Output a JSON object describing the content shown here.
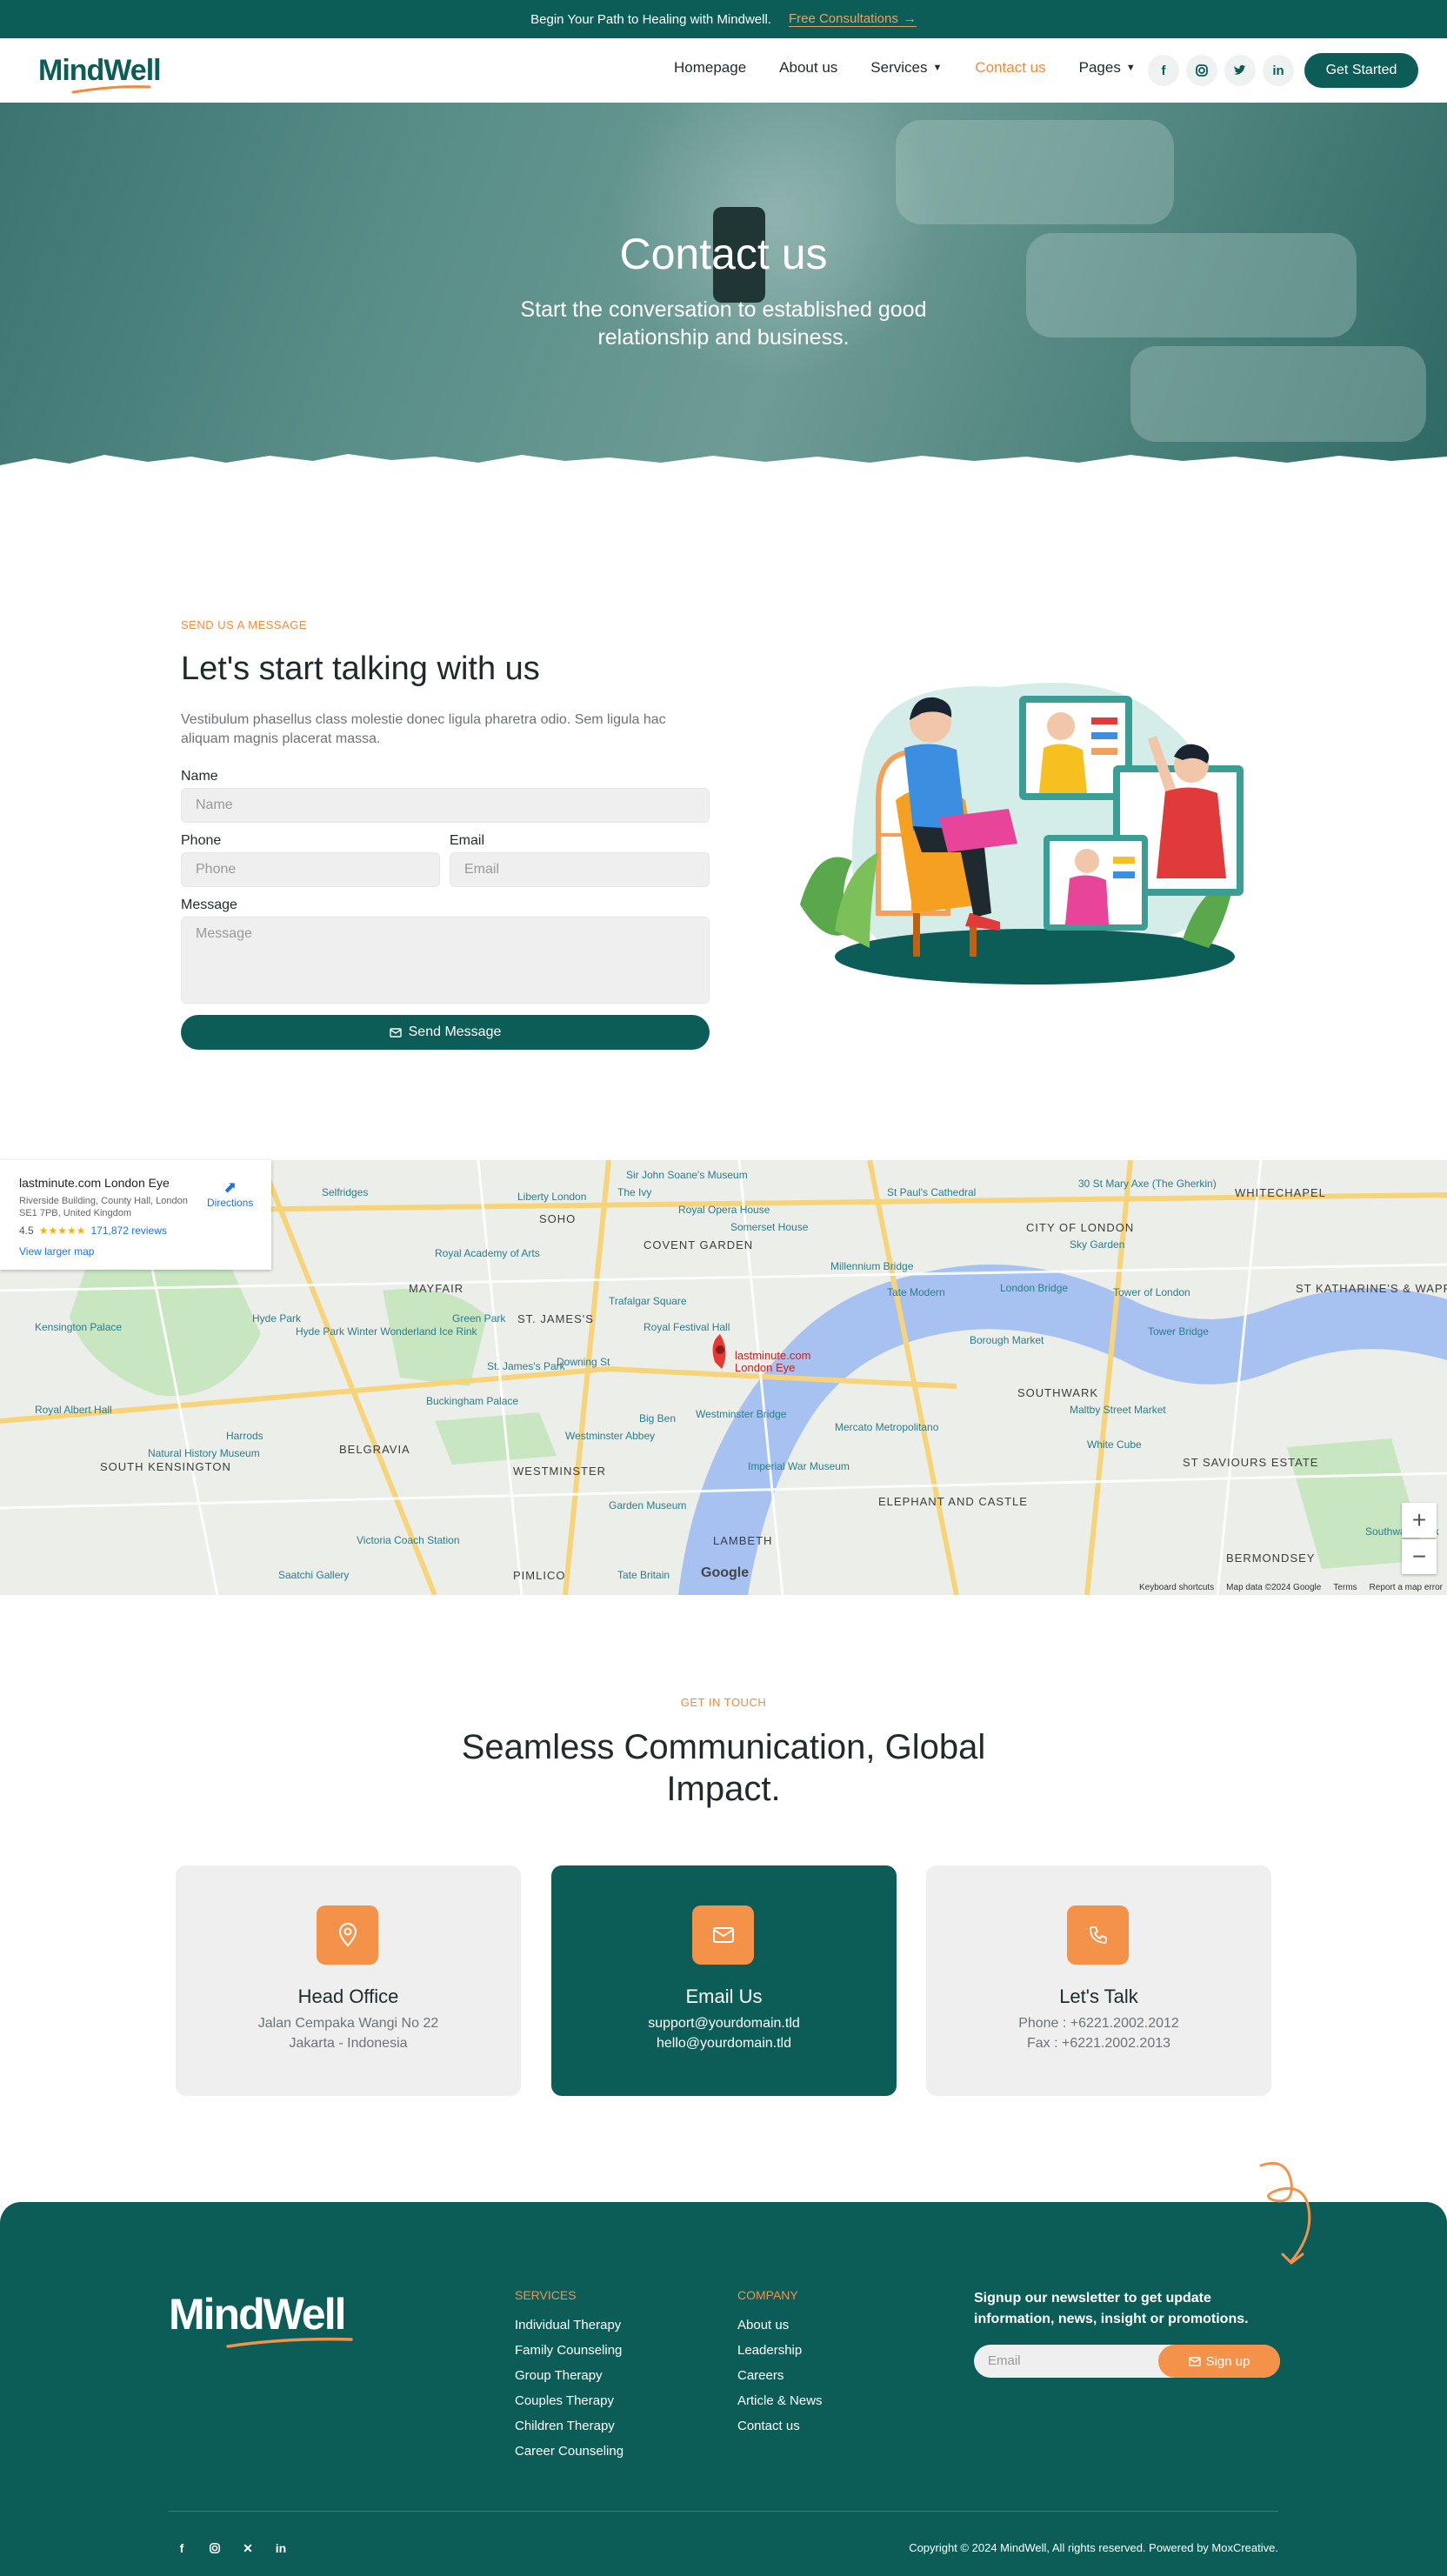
{
  "topbar": {
    "text": "Begin Your Path to Healing with Mindwell.",
    "link": "Free Consultations"
  },
  "nav": {
    "logo": "MindWell",
    "items": [
      {
        "label": "Homepage"
      },
      {
        "label": "About us"
      },
      {
        "label": "Services"
      },
      {
        "label": "Contact us"
      },
      {
        "label": "Pages"
      }
    ],
    "social_icons": [
      "facebook-icon",
      "instagram-icon",
      "twitter-icon",
      "linkedin-icon"
    ],
    "cta": "Get Started"
  },
  "hero": {
    "title": "Contact us",
    "subtitle": "Start the conversation to established good relationship and business."
  },
  "contact_form": {
    "eyebrow": "SEND US A MESSAGE",
    "title": "Let's start talking with us",
    "description": "Vestibulum phasellus class molestie donec ligula pharetra odio. Sem ligula hac aliquam magnis placerat massa.",
    "name_label": "Name",
    "name_placeholder": "Name",
    "phone_label": "Phone",
    "phone_placeholder": "Phone",
    "email_label": "Email",
    "email_placeholder": "Email",
    "message_label": "Message",
    "message_placeholder": "Message",
    "submit": "Send Message"
  },
  "map": {
    "place_name": "lastminute.com London Eye",
    "address": "Riverside Building, County Hall, London SE1 7PB, United Kingdom",
    "rating": "4.5",
    "stars": "★★★★★",
    "reviews": "171,872 reviews",
    "larger_map": "View larger map",
    "directions": "Directions",
    "marker_label": "lastminute.com London Eye",
    "labels": [
      "MAYFAIR",
      "SOHO",
      "COVENT GARDEN",
      "CITY OF LONDON",
      "WHITECHAPEL",
      "ST. JAMES'S",
      "BELGRAVIA",
      "WESTMINSTER",
      "SOUTHWARK",
      "LAMBETH",
      "PIMLICO",
      "BERMONDSEY",
      "ELEPHANT AND CASTLE",
      "ST SAVIOURS ESTATE",
      "ST KATHARINE'S & WAPPING",
      "SOUTH KENSINGTON",
      "Hyde Park",
      "Green Park",
      "Tower Bridge",
      "Big Ben",
      "Tate Modern",
      "Imperial War Museum",
      "Victoria Coach Station",
      "Natural History Museum",
      "Buckingham Palace",
      "Harrods",
      "Borough Market",
      "Millennium Bridge",
      "Westminster Abbey",
      "Garden Museum",
      "Tate Britain",
      "Saatchi Gallery",
      "Sky Garden",
      "Tower of London",
      "Trafalgar Square",
      "Somerset House",
      "Royal Opera House",
      "The Ivy",
      "Liberty London",
      "Selfridges",
      "Royal Academy of Arts",
      "Downing St",
      "Royal Festival Hall",
      "Mercato Metropolitano",
      "Maltby Street Market",
      "White Cube",
      "Kensington Palace",
      "Royal Albert Hall",
      "St. James's Park",
      "Westminster Bridge",
      "Hyde Park Winter Wonderland Ice Rink",
      "London Bridge",
      "Southwark Park",
      "St Paul's Cathedral",
      "30 St Mary Axe (The Gherkin)",
      "Sir John Soane's Museum"
    ],
    "footer": [
      "Keyboard shortcuts",
      "Map data ©2024 Google",
      "Terms",
      "Report a map error"
    ],
    "google": "Google",
    "zoom_in": "+",
    "zoom_out": "−"
  },
  "get_in_touch": {
    "eyebrow": "GET IN TOUCH",
    "title": "Seamless Communication, Global Impact.",
    "cards": [
      {
        "title": "Head Office",
        "line1": "Jalan Cempaka Wangi No 22",
        "line2": "Jakarta - Indonesia",
        "icon": "location-pin-icon"
      },
      {
        "title": "Email Us",
        "line1": "support@yourdomain.tld",
        "line2": "hello@yourdomain.tld",
        "icon": "envelope-icon"
      },
      {
        "title": "Let's Talk",
        "line1": "Phone : +6221.2002.2012",
        "line2": "Fax : +6221.2002.2013",
        "icon": "phone-icon"
      }
    ]
  },
  "footer": {
    "logo": "MindWell",
    "services_heading": "SERVICES",
    "services": [
      "Individual Therapy",
      "Family Counseling",
      "Group Therapy",
      "Couples Therapy",
      "Children Therapy",
      "Career Counseling"
    ],
    "company_heading": "COMPANY",
    "company": [
      "About us",
      "Leadership",
      "Careers",
      "Article & News",
      "Contact us"
    ],
    "newsletter_text": "Signup our newsletter to get update information, news, insight or promotions.",
    "email_placeholder": "Email",
    "signup": "Sign up",
    "copyright": "Copyright © 2024 MindWell, All rights reserved. Powered by MoxCreative.",
    "social_icons": [
      "facebook-icon",
      "instagram-icon",
      "x-icon",
      "linkedin-icon"
    ]
  },
  "colors": {
    "primary": "#0c5c57",
    "accent": "#f08a3c",
    "light": "#efefef"
  }
}
